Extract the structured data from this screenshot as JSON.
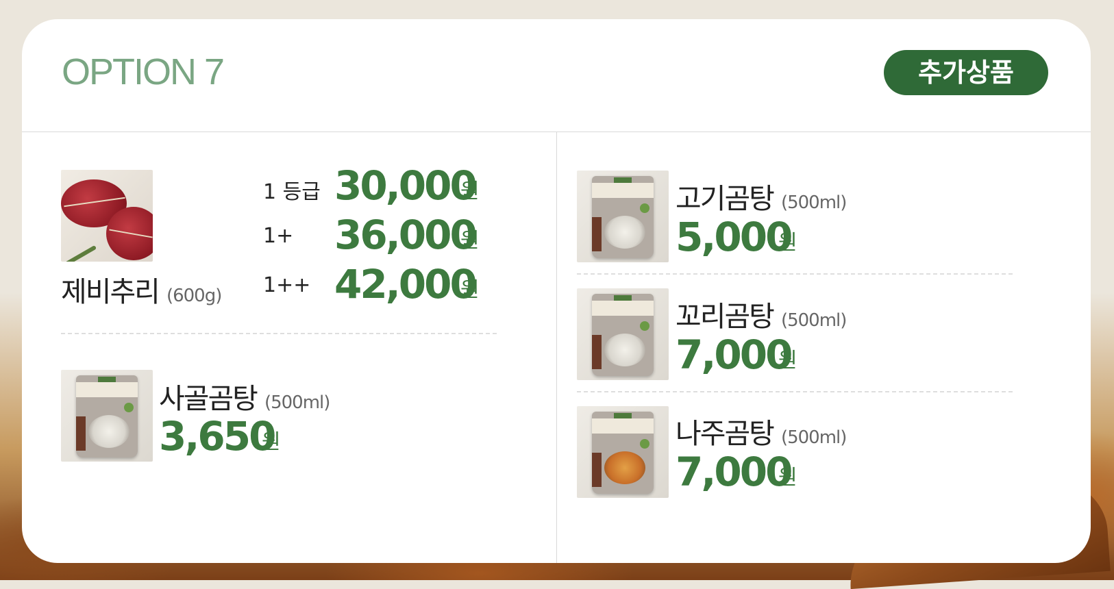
{
  "header": {
    "title": "OPTION 7",
    "badge": "추가상품"
  },
  "left": {
    "jebichuri": {
      "name": "제비추리",
      "size": "(600g)",
      "grades": [
        {
          "grade": "1 등급",
          "price": "30,000",
          "unit": "원"
        },
        {
          "grade": "1+",
          "price": "36,000",
          "unit": "원"
        },
        {
          "grade": "1++",
          "price": "42,000",
          "unit": "원"
        }
      ]
    },
    "sagol": {
      "name": "사골곰탕",
      "size": "(500ml)",
      "price": "3,650",
      "unit": "원"
    }
  },
  "right": {
    "items": [
      {
        "name": "고기곰탕",
        "size": "(500ml)",
        "price": "5,000",
        "unit": "원"
      },
      {
        "name": "꼬리곰탕",
        "size": "(500ml)",
        "price": "7,000",
        "unit": "원"
      },
      {
        "name": "나주곰탕",
        "size": "(500ml)",
        "price": "7,000",
        "unit": "원"
      }
    ]
  },
  "colors": {
    "accent": "#3d7a3f",
    "badge": "#2f6a37",
    "title": "#7aa683"
  },
  "icons": [
    "beef-photo",
    "gomtang-pouch-photo"
  ]
}
